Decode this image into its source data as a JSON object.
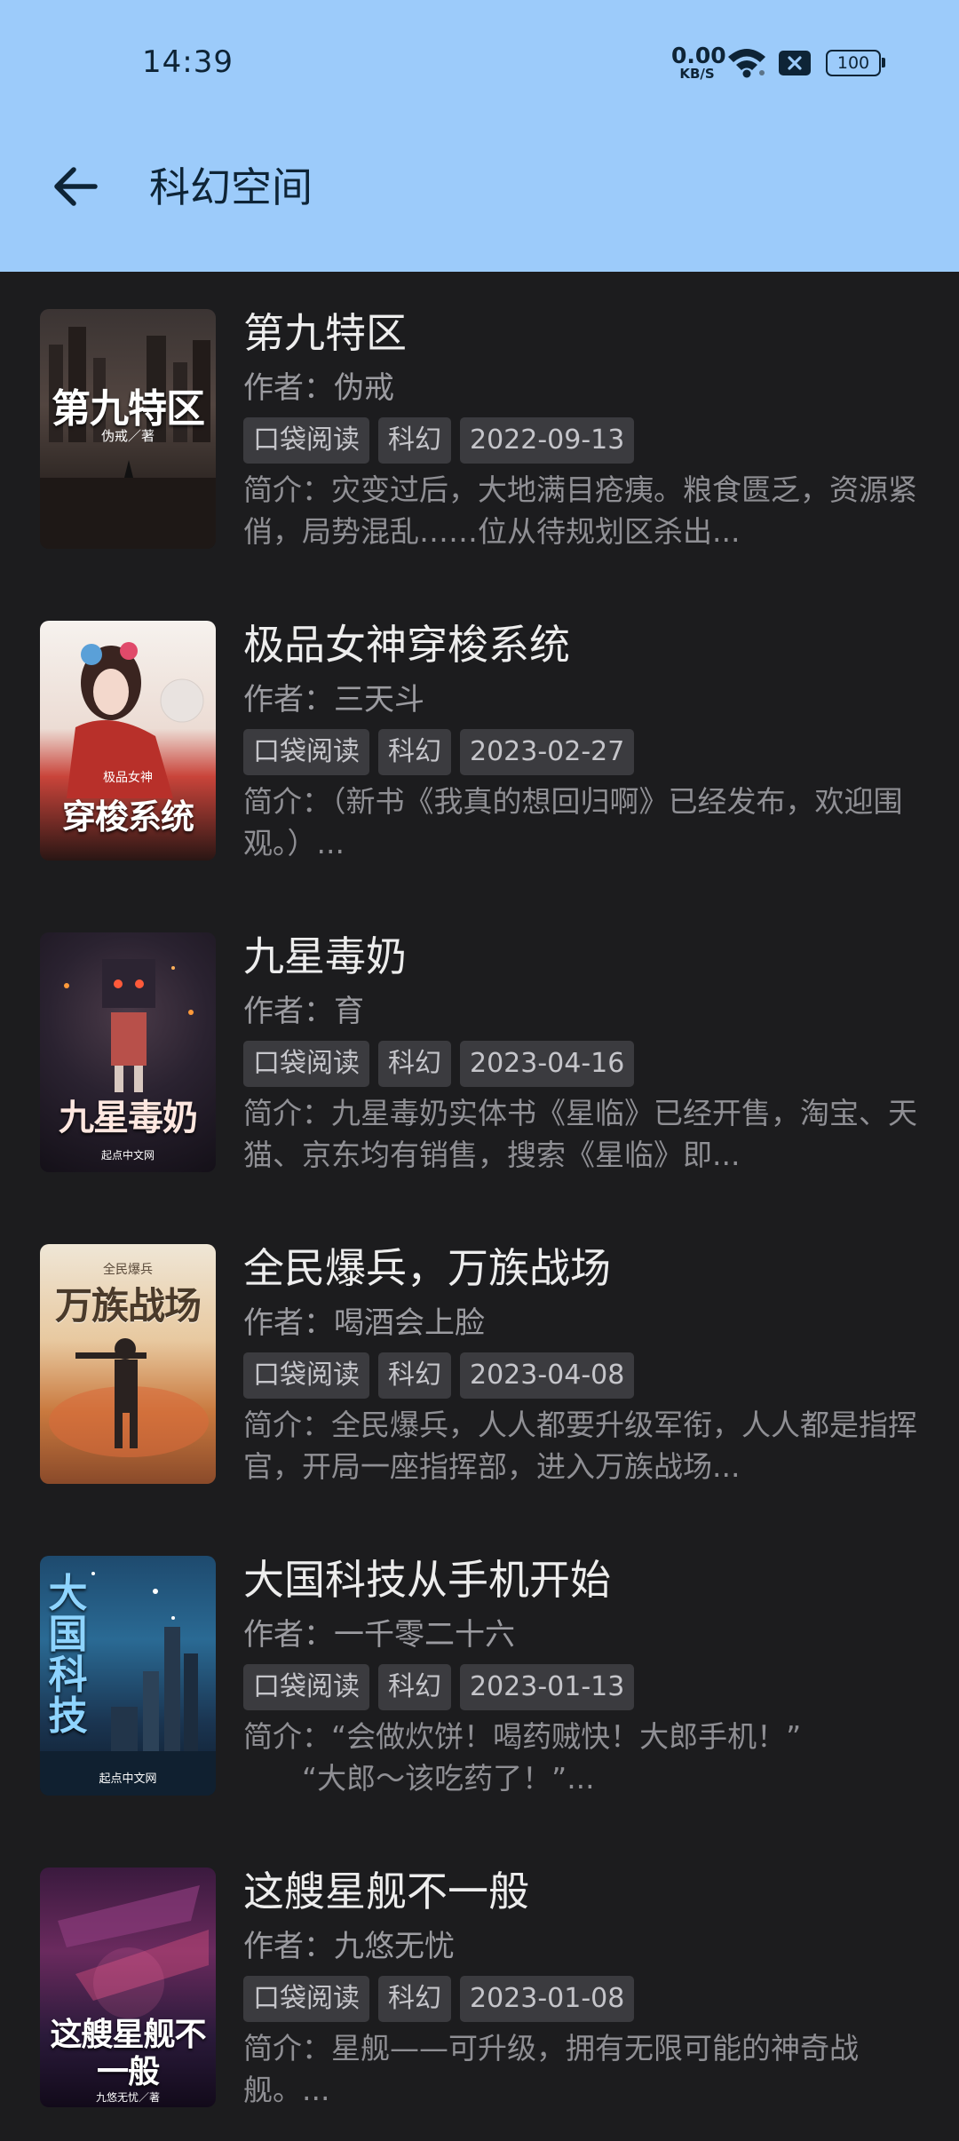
{
  "status_bar": {
    "time": "14:39",
    "net_speed_value": "0.00",
    "net_speed_unit": "KB/S",
    "battery": "100",
    "icons": [
      "wifi-icon",
      "sim-disabled-icon",
      "battery-icon"
    ]
  },
  "header": {
    "title": "科幻空间",
    "back_icon": "arrow-left-icon",
    "background_color": "#9ccbfa"
  },
  "books": [
    {
      "title": "第九特区",
      "author": "作者：伪戒",
      "tags": [
        "口袋阅读",
        "科幻",
        "2022-09-13"
      ],
      "intro": "简介：灾变过后，大地满目疮痍。粮食匮乏，资源紧俏，局势混乱……位从待规划区杀出...",
      "cover_text": "第九特区",
      "cover_sub": "伪戒／著"
    },
    {
      "title": "极品女神穿梭系统",
      "author": "作者：三天斗",
      "tags": [
        "口袋阅读",
        "科幻",
        "2023-02-27"
      ],
      "intro": "简介：（新书《我真的想回归啊》已经发布，欢迎围观。）...",
      "cover_text": "穿梭系统",
      "cover_sub": "极品女神"
    },
    {
      "title": "九星毒奶",
      "author": "作者：育",
      "tags": [
        "口袋阅读",
        "科幻",
        "2023-04-16"
      ],
      "intro": "简介：九星毒奶实体书《星临》已经开售，淘宝、天猫、京东均有销售，搜索《星临》即...",
      "cover_text": "九星毒奶",
      "cover_sub": "起点中文网"
    },
    {
      "title": "全民爆兵，万族战场",
      "author": "作者：喝酒会上脸",
      "tags": [
        "口袋阅读",
        "科幻",
        "2023-04-08"
      ],
      "intro": "简介：全民爆兵，人人都要升级军衔，人人都是指挥官，开局一座指挥部，进入万族战场...",
      "cover_text": "万族战场",
      "cover_sub": "全民爆兵"
    },
    {
      "title": "大国科技从手机开始",
      "author": "作者：一千零二十六",
      "tags": [
        "口袋阅读",
        "科幻",
        "2023-01-13"
      ],
      "intro": "简介：“会做炊饼！喝药贼快！大郎手机！”\n　　“大郎～该吃药了！”...",
      "cover_text": "大国科技",
      "cover_sub": "起点中文网"
    },
    {
      "title": "这艘星舰不一般",
      "author": "作者：九悠无忧",
      "tags": [
        "口袋阅读",
        "科幻",
        "2023-01-08"
      ],
      "intro": "简介：星舰——可升级，拥有无限可能的神奇战舰。...",
      "cover_text": "这艘星舰不一般",
      "cover_sub": "九悠无忧／著"
    }
  ]
}
